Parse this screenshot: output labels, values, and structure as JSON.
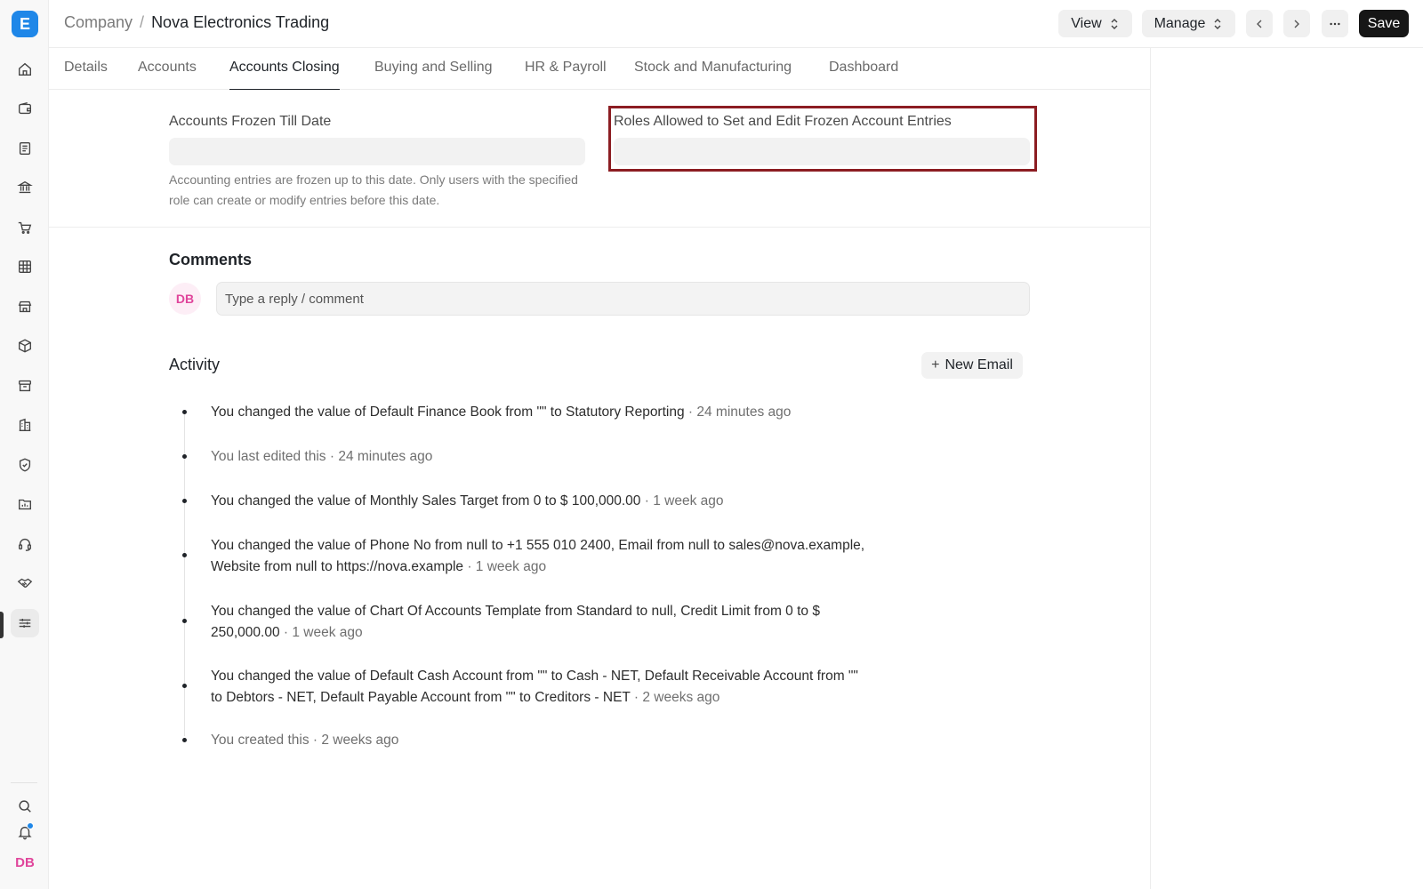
{
  "sidebar": {
    "logo": "E",
    "items": [
      {
        "icon": "home-icon"
      },
      {
        "icon": "wallet-icon"
      },
      {
        "icon": "document-icon"
      },
      {
        "icon": "bank-icon"
      },
      {
        "icon": "cart-icon"
      },
      {
        "icon": "table-icon"
      },
      {
        "icon": "store-icon"
      },
      {
        "icon": "box-icon"
      },
      {
        "icon": "archive-icon"
      },
      {
        "icon": "building-icon"
      },
      {
        "icon": "shield-icon"
      },
      {
        "icon": "folder-chart-icon"
      },
      {
        "icon": "headset-icon"
      },
      {
        "icon": "handshake-icon"
      },
      {
        "icon": "sliders-icon"
      }
    ],
    "bottom": {
      "search_icon": "search-icon",
      "bell_icon": "bell-icon",
      "avatar": "DB"
    }
  },
  "header": {
    "breadcrumb_parent": "Company",
    "breadcrumb_sep": "/",
    "title": "Nova Electronics Trading",
    "view_label": "View",
    "manage_label": "Manage",
    "save_label": "Save"
  },
  "tabs": [
    {
      "label": "Details"
    },
    {
      "label": "Accounts"
    },
    {
      "label": "Accounts Closing"
    },
    {
      "label": "Buying and Selling"
    },
    {
      "label": "HR & Payroll"
    },
    {
      "label": "Stock and Manufacturing"
    },
    {
      "label": "Dashboard"
    }
  ],
  "active_tab": "Accounts Closing",
  "form": {
    "frozen_till_label": "Accounts Frozen Till Date",
    "frozen_till_value": "",
    "frozen_till_help": "Accounting entries are frozen up to this date. Only users with the specified role can create or modify entries before this date.",
    "roles_label": "Roles Allowed to Set and Edit Frozen Account Entries",
    "roles_value": ""
  },
  "comments": {
    "title": "Comments",
    "avatar": "DB",
    "placeholder": "Type a reply / comment"
  },
  "activity": {
    "title": "Activity",
    "new_email_label": "New Email",
    "items": [
      {
        "text": "You changed the value of Default Finance Book from \"\" to Statutory Reporting",
        "time": "· 24 minutes ago"
      },
      {
        "text": "You last edited this",
        "time": "· 24 minutes ago"
      },
      {
        "text": "You changed the value of Monthly Sales Target from 0 to $ 100,000.00",
        "time": "· 1 week ago"
      },
      {
        "text": "You changed the value of Phone No from null to +1 555 010 2400, Email from null to sales@nova.example, Website from null to https://nova.example",
        "time": "· 1 week ago"
      },
      {
        "text": "You changed the value of Chart Of Accounts Template from Standard to null, Credit Limit from 0 to $ 250,000.00",
        "time": "· 1 week ago"
      },
      {
        "text": "You changed the value of Default Cash Account from \"\" to Cash - NET, Default Receivable Account from \"\" to Debtors - NET, Default Payable Account from \"\" to Creditors - NET",
        "time": "· 2 weeks ago"
      },
      {
        "text": "You created this",
        "time": "· 2 weeks ago"
      }
    ]
  }
}
